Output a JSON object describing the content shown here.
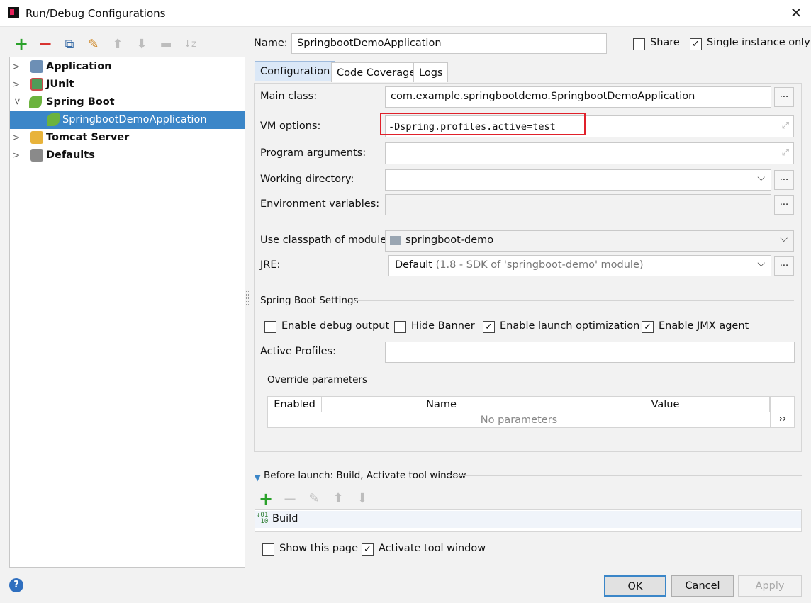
{
  "window": {
    "title": "Run/Debug Configurations"
  },
  "toolbar": {
    "add": "+",
    "remove": "−",
    "copy": "⧉",
    "edit": "✎",
    "up": "⬆",
    "down": "⬇",
    "folder": "▬",
    "sort": "↓z"
  },
  "tree": {
    "items": [
      {
        "label": "Application",
        "expanded": false
      },
      {
        "label": "JUnit",
        "expanded": false
      },
      {
        "label": "Spring Boot",
        "expanded": true
      },
      {
        "label": "SpringbootDemoApplication",
        "selected": true
      },
      {
        "label": "Tomcat Server",
        "expanded": false
      },
      {
        "label": "Defaults",
        "expanded": false
      }
    ]
  },
  "name": {
    "label": "Name:",
    "value": "SpringbootDemoApplication"
  },
  "share": {
    "label": "Share",
    "checked": false
  },
  "single_instance": {
    "label": "Single instance only",
    "checked": true
  },
  "tabs": [
    "Configuration",
    "Code Coverage",
    "Logs"
  ],
  "form": {
    "main_class": {
      "label": "Main class:",
      "value": "com.example.springbootdemo.SpringbootDemoApplication"
    },
    "vm_options": {
      "label": "VM options:",
      "value": "-Dspring.profiles.active=test"
    },
    "program_arguments": {
      "label": "Program arguments:",
      "value": ""
    },
    "working_directory": {
      "label": "Working directory:",
      "value": ""
    },
    "environment_variables": {
      "label": "Environment variables:",
      "value": ""
    },
    "classpath_module": {
      "label": "Use classpath of module:",
      "value": "springboot-demo"
    },
    "jre": {
      "label": "JRE:",
      "value": "Default",
      "detail": "(1.8 - SDK of 'springboot-demo' module)"
    },
    "browse": "..."
  },
  "spring_boot_settings": {
    "heading": "Spring Boot Settings",
    "options": [
      {
        "label": "Enable debug output",
        "checked": false
      },
      {
        "label": "Hide Banner",
        "checked": false
      },
      {
        "label": "Enable launch optimization",
        "checked": true
      },
      {
        "label": "Enable JMX agent",
        "checked": true
      }
    ],
    "active_profiles": {
      "label": "Active Profiles:",
      "value": ""
    }
  },
  "override": {
    "heading": "Override parameters",
    "columns": [
      "Enabled",
      "Name",
      "Value"
    ],
    "empty_text": "No parameters",
    "more": "››"
  },
  "before_launch": {
    "heading": "Before launch: Build, Activate tool window",
    "items": [
      "Build"
    ],
    "show_this_page": {
      "label": "Show this page",
      "checked": false
    },
    "activate_tool_window": {
      "label": "Activate tool window",
      "checked": true
    }
  },
  "footer": {
    "help": "?",
    "ok": "OK",
    "cancel": "Cancel",
    "apply": "Apply"
  },
  "colors": {
    "selection": "#3b86c8",
    "accent_add": "#2aa12a",
    "accent_remove": "#d8312e",
    "highlight_box": "#e0202a"
  }
}
